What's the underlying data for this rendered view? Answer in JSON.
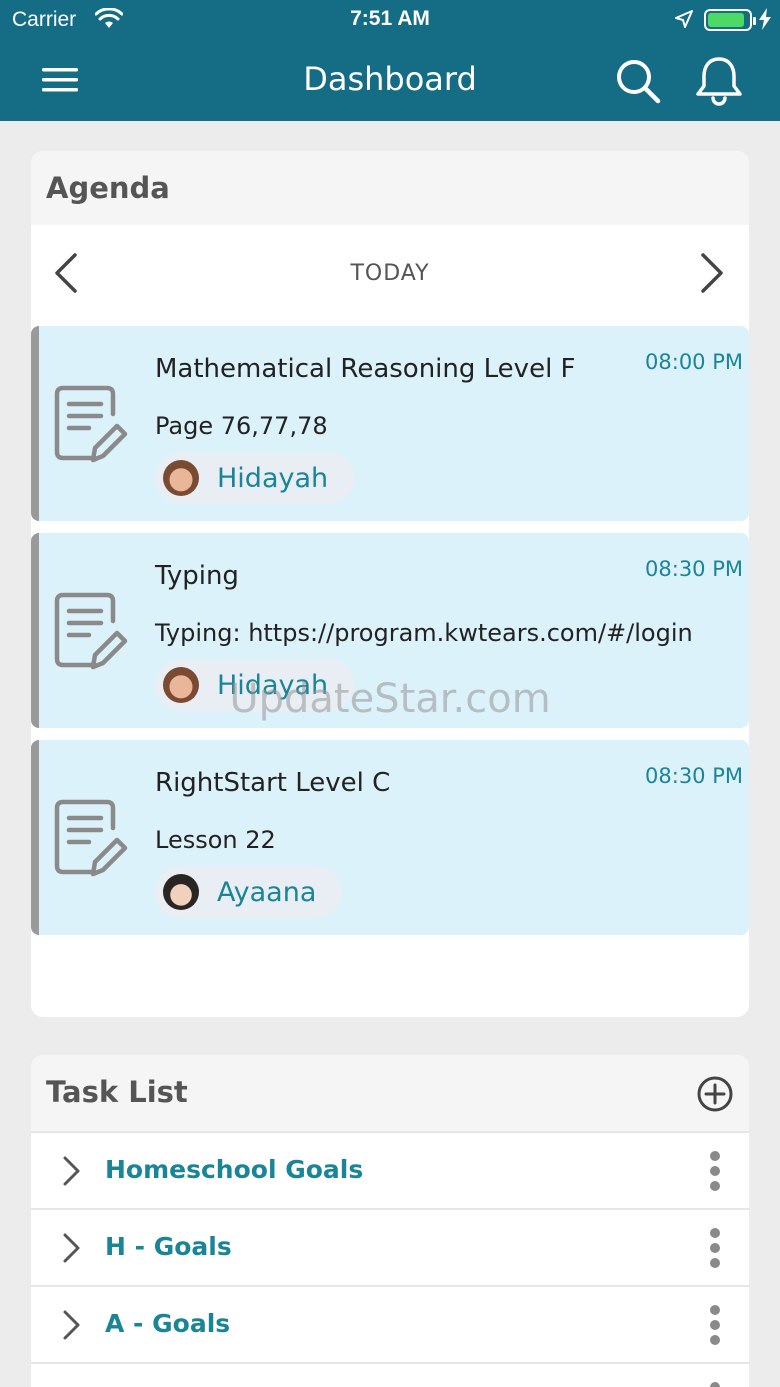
{
  "status_bar": {
    "carrier": "Carrier",
    "time": "7:51 AM"
  },
  "header": {
    "title": "Dashboard",
    "menu_icon": "hamburger-menu-icon",
    "search_icon": "search-icon",
    "bell_icon": "bell-icon"
  },
  "agenda": {
    "title": "Agenda",
    "day_label": "TODAY",
    "events": [
      {
        "title": "Mathematical Reasoning Level F",
        "time": "08:00 PM",
        "description": "Page 76,77,78",
        "student": "Hidayah"
      },
      {
        "title": "Typing",
        "time": "08:30 PM",
        "description": "Typing:  https://program.kwtears.com/#/login",
        "student": "Hidayah"
      },
      {
        "title": "RightStart Level C",
        "time": "08:30 PM",
        "description": "Lesson 22",
        "student": "Ayaana"
      }
    ]
  },
  "watermark": "UpdateStar.com",
  "task_list": {
    "title": "Task List",
    "items": [
      {
        "label": "Homeschool Goals"
      },
      {
        "label": "H - Goals"
      },
      {
        "label": "A - Goals"
      }
    ]
  },
  "colors": {
    "header": "#146d85",
    "accent": "#1a8597",
    "event_bg": "#dcf2fb",
    "battery": "#4cd964"
  }
}
